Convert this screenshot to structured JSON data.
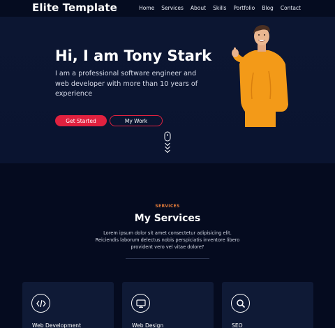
{
  "nav": {
    "brand": "Elite Template",
    "items": [
      "Home",
      "Services",
      "About",
      "Skills",
      "Portfolio",
      "Blog",
      "Contact"
    ]
  },
  "hero": {
    "title": "Hi, I am Tony Stark",
    "description": "I am a professional software engineer and web developer with more than 10 years of experience",
    "primary_button": "Get Started",
    "secondary_button": "My Work"
  },
  "services": {
    "kicker": "SERVICES",
    "title": "My Services",
    "description": "Lorem ipsum dolor sit amet consectetur adipisicing elit. Reiciendis laborum delectus nobis perspiciatis inventore libero provident vero vel vitae dolore?",
    "cards": [
      {
        "label": "Web Development",
        "icon": "code-icon"
      },
      {
        "label": "Web Design",
        "icon": "monitor-icon"
      },
      {
        "label": "SEO",
        "icon": "search-icon"
      }
    ]
  },
  "colors": {
    "background": "#050b1f",
    "hero": "#0b1531",
    "accent": "#e0213f",
    "kicker": "#e07a3a",
    "card": "#0f1a36"
  }
}
